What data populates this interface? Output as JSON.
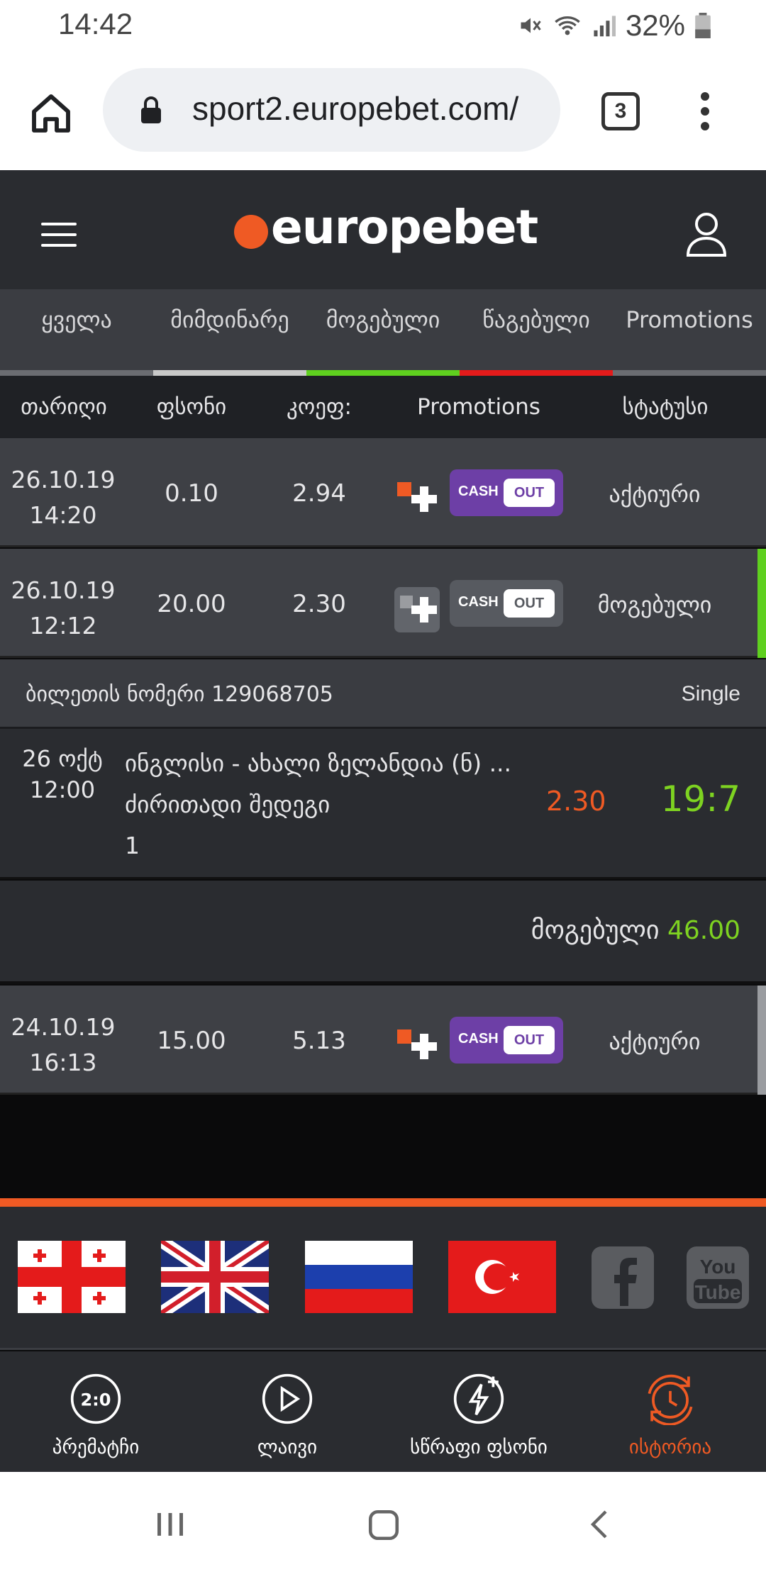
{
  "status_bar": {
    "time": "14:42",
    "battery": "32%"
  },
  "browser": {
    "url": "sport2.europebet.com/",
    "tab_count": "3"
  },
  "site": {
    "logo_text": "europebet",
    "brand_color": "#ef5a24"
  },
  "filter_tabs": [
    {
      "label": "ყველა",
      "color": "#3b3d42"
    },
    {
      "label": "მიმდინარე",
      "color": "#c9c9c9"
    },
    {
      "label": "მოგებული",
      "color": "#5fd01f"
    },
    {
      "label": "წაგებული",
      "color": "#e41b1b"
    },
    {
      "label": "Promotions",
      "color": "#3b3d42"
    }
  ],
  "table_header": {
    "date": "თარიღი",
    "stake": "ფსონი",
    "odds": "კოეფ:",
    "promotions": "Promotions",
    "status": "სტატუსი"
  },
  "bets": [
    {
      "date": "26.10.19",
      "time": "14:20",
      "stake": "0.10",
      "odds": "2.94",
      "cashout_text": "CASH",
      "cashout_btn": "OUT",
      "status": "აქტიური",
      "state": "active"
    },
    {
      "date": "26.10.19",
      "time": "12:12",
      "stake": "20.00",
      "odds": "2.30",
      "cashout_text": "CASH",
      "cashout_btn": "OUT",
      "status": "მოგებული",
      "state": "won"
    },
    {
      "date": "24.10.19",
      "time": "16:13",
      "stake": "15.00",
      "odds": "5.13",
      "cashout_text": "CASH",
      "cashout_btn": "OUT",
      "status": "აქტიური",
      "state": "active"
    }
  ],
  "ticket": {
    "number_label": "ბილეთის ნომერი 129068705",
    "type": "Single",
    "event_date": "26 ოქტ",
    "event_time": "12:00",
    "event_name": "ინგლისი - ახალი ზელანდია (ნ) ...",
    "market": "ძირითადი შედეგი",
    "selection": "1",
    "odds": "2.30",
    "score": "19:7",
    "result_label": "მოგებული",
    "result_value": "46.00"
  },
  "bottom_nav": [
    {
      "label": "პრემატჩი",
      "icon": "score-icon",
      "active": false
    },
    {
      "label": "ლაივი",
      "icon": "play-icon",
      "active": false
    },
    {
      "label": "სწრაფი ფსონი",
      "icon": "lightning-icon",
      "active": false
    },
    {
      "label": "ისტორია",
      "icon": "history-icon",
      "active": true
    }
  ],
  "social": {
    "facebook_icon": "facebook-icon",
    "youtube_label": "You Tube"
  }
}
